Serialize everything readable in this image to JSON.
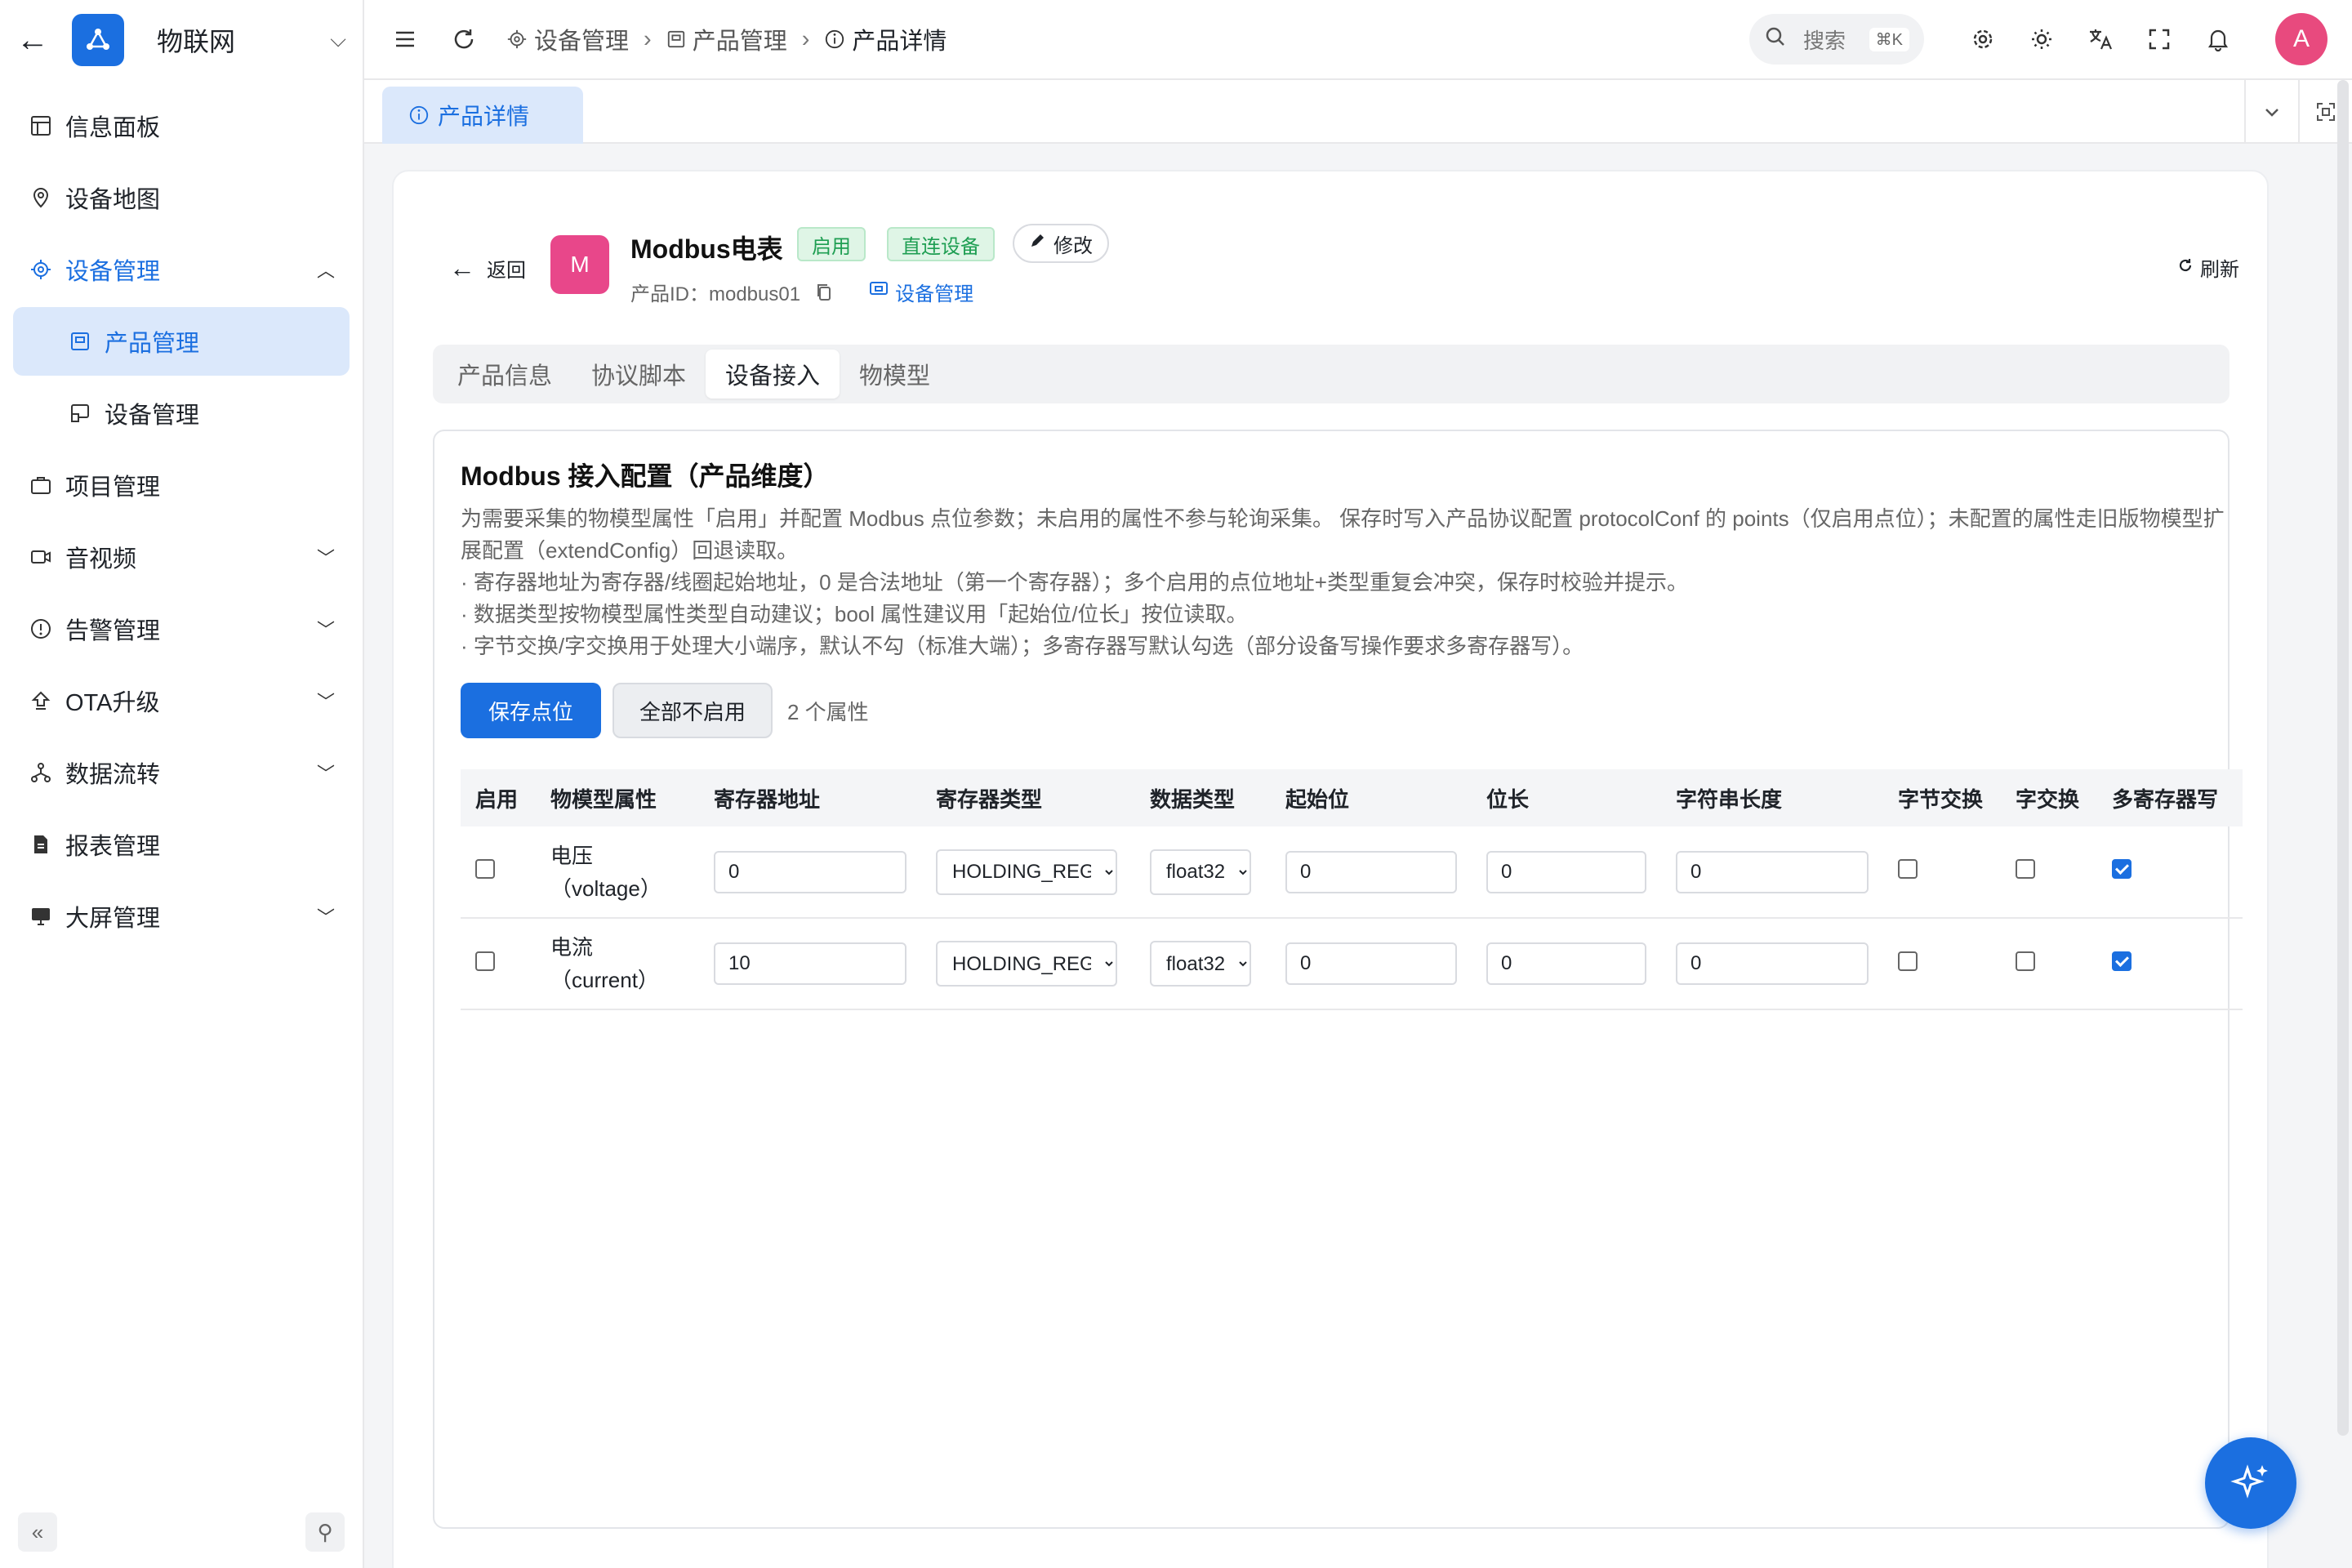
{
  "app": {
    "name": "物联网"
  },
  "sidebar": {
    "items": [
      {
        "label": "信息面板",
        "icon": "dashboard-icon"
      },
      {
        "label": "设备地图",
        "icon": "map-pin-icon"
      },
      {
        "label": "设备管理",
        "icon": "device-gear-icon",
        "expanded": true,
        "children": [
          {
            "label": "产品管理",
            "selected": true
          },
          {
            "label": "设备管理"
          }
        ]
      },
      {
        "label": "项目管理",
        "icon": "briefcase-icon"
      },
      {
        "label": "音视频",
        "icon": "video-icon"
      },
      {
        "label": "告警管理",
        "icon": "alert-icon"
      },
      {
        "label": "OTA升级",
        "icon": "upload-icon"
      },
      {
        "label": "数据流转",
        "icon": "flow-icon"
      },
      {
        "label": "报表管理",
        "icon": "report-icon"
      },
      {
        "label": "大屏管理",
        "icon": "screen-icon"
      }
    ]
  },
  "topbar": {
    "breadcrumb": [
      "设备管理",
      "产品管理",
      "产品详情"
    ],
    "search_label": "搜索",
    "search_shortcut": "⌘K",
    "avatar": "A"
  },
  "tabbar": {
    "active_tab": "产品详情"
  },
  "product": {
    "back_label": "返回",
    "logo_letter": "M",
    "name": "Modbus电表",
    "tags": [
      "启用",
      "直连设备"
    ],
    "edit_label": "修改",
    "id_text": "产品ID：modbus01",
    "device_link": "设备管理",
    "refresh_label": "刷新"
  },
  "subtabs": [
    "产品信息",
    "协议脚本",
    "设备接入",
    "物模型"
  ],
  "active_subtab": "设备接入",
  "panel": {
    "title": "Modbus 接入配置（产品维度）",
    "desc_lines": [
      "为需要采集的物模型属性「启用」并配置 Modbus 点位参数；未启用的属性不参与轮询采集。 保存时写入产品协议配置 protocolConf 的 points（仅启用点位）；未配置的属性走旧版物模型扩",
      "展配置（extendConfig）回退读取。",
      "· 寄存器地址为寄存器/线圈起始地址，0 是合法地址（第一个寄存器）；多个启用的点位地址+类型重复会冲突，保存时校验并提示。",
      "· 数据类型按物模型属性类型自动建议；bool 属性建议用「起始位/位长」按位读取。",
      "· 字节交换/字交换用于处理大小端序，默认不勾（标准大端）；多寄存器写默认勾选（部分设备写操作要求多寄存器写）。"
    ],
    "save_label": "保存点位",
    "disable_all_label": "全部不启用",
    "count_label": "2 个属性"
  },
  "table": {
    "headers": [
      "启用",
      "物模型属性",
      "寄存器地址",
      "寄存器类型",
      "数据类型",
      "起始位",
      "位长",
      "字符串长度",
      "字节交换",
      "字交换",
      "多寄存器写"
    ],
    "rows": [
      {
        "enabled": false,
        "attr_name": "电压",
        "attr_key": "（voltage）",
        "address": "0",
        "reg_type": "HOLDING_REGISTER",
        "data_type": "float32",
        "start_bit": "0",
        "bit_len": "0",
        "str_len": "0",
        "byte_swap": false,
        "word_swap": false,
        "multi_write": true
      },
      {
        "enabled": false,
        "attr_name": "电流",
        "attr_key": "（current）",
        "address": "10",
        "reg_type": "HOLDING_REGISTER",
        "data_type": "float32",
        "start_bit": "0",
        "bit_len": "0",
        "str_len": "0",
        "byte_swap": false,
        "word_swap": false,
        "multi_write": true
      }
    ]
  },
  "colors": {
    "primary": "#1b6fe0",
    "success": "#1e9e52",
    "avatar": "#e84a7e",
    "product_logo": "#e8478a"
  }
}
